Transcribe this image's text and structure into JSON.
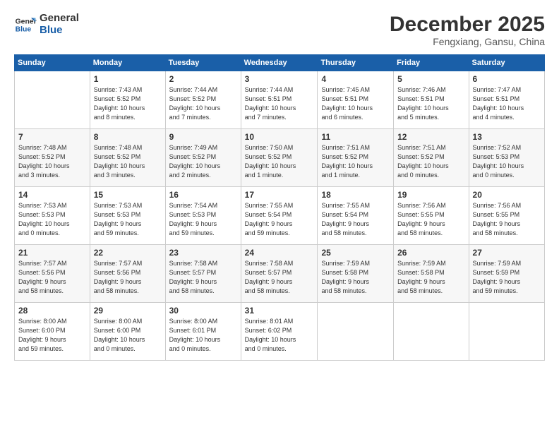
{
  "logo": {
    "line1": "General",
    "line2": "Blue"
  },
  "title": "December 2025",
  "subtitle": "Fengxiang, Gansu, China",
  "headers": [
    "Sunday",
    "Monday",
    "Tuesday",
    "Wednesday",
    "Thursday",
    "Friday",
    "Saturday"
  ],
  "weeks": [
    [
      {
        "num": "",
        "info": ""
      },
      {
        "num": "1",
        "info": "Sunrise: 7:43 AM\nSunset: 5:52 PM\nDaylight: 10 hours\nand 8 minutes."
      },
      {
        "num": "2",
        "info": "Sunrise: 7:44 AM\nSunset: 5:52 PM\nDaylight: 10 hours\nand 7 minutes."
      },
      {
        "num": "3",
        "info": "Sunrise: 7:44 AM\nSunset: 5:51 PM\nDaylight: 10 hours\nand 7 minutes."
      },
      {
        "num": "4",
        "info": "Sunrise: 7:45 AM\nSunset: 5:51 PM\nDaylight: 10 hours\nand 6 minutes."
      },
      {
        "num": "5",
        "info": "Sunrise: 7:46 AM\nSunset: 5:51 PM\nDaylight: 10 hours\nand 5 minutes."
      },
      {
        "num": "6",
        "info": "Sunrise: 7:47 AM\nSunset: 5:51 PM\nDaylight: 10 hours\nand 4 minutes."
      }
    ],
    [
      {
        "num": "7",
        "info": "Sunrise: 7:48 AM\nSunset: 5:52 PM\nDaylight: 10 hours\nand 3 minutes."
      },
      {
        "num": "8",
        "info": "Sunrise: 7:48 AM\nSunset: 5:52 PM\nDaylight: 10 hours\nand 3 minutes."
      },
      {
        "num": "9",
        "info": "Sunrise: 7:49 AM\nSunset: 5:52 PM\nDaylight: 10 hours\nand 2 minutes."
      },
      {
        "num": "10",
        "info": "Sunrise: 7:50 AM\nSunset: 5:52 PM\nDaylight: 10 hours\nand 1 minute."
      },
      {
        "num": "11",
        "info": "Sunrise: 7:51 AM\nSunset: 5:52 PM\nDaylight: 10 hours\nand 1 minute."
      },
      {
        "num": "12",
        "info": "Sunrise: 7:51 AM\nSunset: 5:52 PM\nDaylight: 10 hours\nand 0 minutes."
      },
      {
        "num": "13",
        "info": "Sunrise: 7:52 AM\nSunset: 5:53 PM\nDaylight: 10 hours\nand 0 minutes."
      }
    ],
    [
      {
        "num": "14",
        "info": "Sunrise: 7:53 AM\nSunset: 5:53 PM\nDaylight: 10 hours\nand 0 minutes."
      },
      {
        "num": "15",
        "info": "Sunrise: 7:53 AM\nSunset: 5:53 PM\nDaylight: 9 hours\nand 59 minutes."
      },
      {
        "num": "16",
        "info": "Sunrise: 7:54 AM\nSunset: 5:53 PM\nDaylight: 9 hours\nand 59 minutes."
      },
      {
        "num": "17",
        "info": "Sunrise: 7:55 AM\nSunset: 5:54 PM\nDaylight: 9 hours\nand 59 minutes."
      },
      {
        "num": "18",
        "info": "Sunrise: 7:55 AM\nSunset: 5:54 PM\nDaylight: 9 hours\nand 58 minutes."
      },
      {
        "num": "19",
        "info": "Sunrise: 7:56 AM\nSunset: 5:55 PM\nDaylight: 9 hours\nand 58 minutes."
      },
      {
        "num": "20",
        "info": "Sunrise: 7:56 AM\nSunset: 5:55 PM\nDaylight: 9 hours\nand 58 minutes."
      }
    ],
    [
      {
        "num": "21",
        "info": "Sunrise: 7:57 AM\nSunset: 5:56 PM\nDaylight: 9 hours\nand 58 minutes."
      },
      {
        "num": "22",
        "info": "Sunrise: 7:57 AM\nSunset: 5:56 PM\nDaylight: 9 hours\nand 58 minutes."
      },
      {
        "num": "23",
        "info": "Sunrise: 7:58 AM\nSunset: 5:57 PM\nDaylight: 9 hours\nand 58 minutes."
      },
      {
        "num": "24",
        "info": "Sunrise: 7:58 AM\nSunset: 5:57 PM\nDaylight: 9 hours\nand 58 minutes."
      },
      {
        "num": "25",
        "info": "Sunrise: 7:59 AM\nSunset: 5:58 PM\nDaylight: 9 hours\nand 58 minutes."
      },
      {
        "num": "26",
        "info": "Sunrise: 7:59 AM\nSunset: 5:58 PM\nDaylight: 9 hours\nand 58 minutes."
      },
      {
        "num": "27",
        "info": "Sunrise: 7:59 AM\nSunset: 5:59 PM\nDaylight: 9 hours\nand 59 minutes."
      }
    ],
    [
      {
        "num": "28",
        "info": "Sunrise: 8:00 AM\nSunset: 6:00 PM\nDaylight: 9 hours\nand 59 minutes."
      },
      {
        "num": "29",
        "info": "Sunrise: 8:00 AM\nSunset: 6:00 PM\nDaylight: 10 hours\nand 0 minutes."
      },
      {
        "num": "30",
        "info": "Sunrise: 8:00 AM\nSunset: 6:01 PM\nDaylight: 10 hours\nand 0 minutes."
      },
      {
        "num": "31",
        "info": "Sunrise: 8:01 AM\nSunset: 6:02 PM\nDaylight: 10 hours\nand 0 minutes."
      },
      {
        "num": "",
        "info": ""
      },
      {
        "num": "",
        "info": ""
      },
      {
        "num": "",
        "info": ""
      }
    ]
  ]
}
